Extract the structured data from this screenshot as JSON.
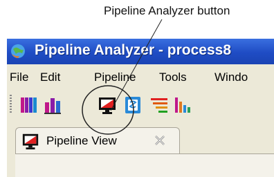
{
  "callout": {
    "label": "Pipeline Analyzer button"
  },
  "window": {
    "title": "Pipeline Analyzer - process8"
  },
  "menu": {
    "items": [
      "File",
      "Edit",
      "Pipeline",
      "Tools",
      "Windo"
    ]
  },
  "toolbar": {
    "buttons": [
      {
        "icon": "multicolor-bar-chart-icon"
      },
      {
        "icon": "bar-chart-icon"
      },
      {
        "icon": "pipeline-analyzer-icon"
      },
      {
        "icon": "blue-document-icon"
      },
      {
        "icon": "horizontal-bars-icon"
      },
      {
        "icon": "small-bar-chart-icon"
      }
    ]
  },
  "tab": {
    "label": "Pipeline View",
    "icon": "pipeline-view-icon",
    "close_icon": "close-icon"
  }
}
